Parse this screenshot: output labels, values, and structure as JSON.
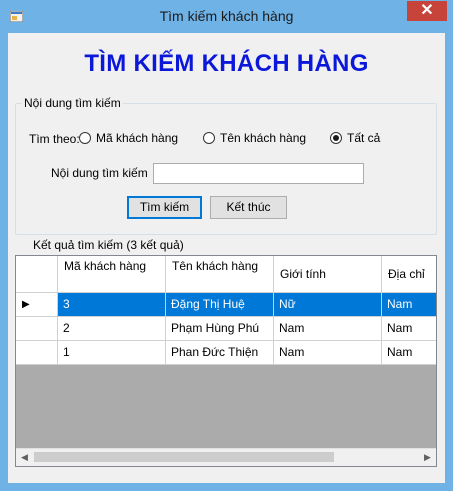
{
  "window": {
    "title": "Tìm kiếm khách hàng",
    "close_label": "✕"
  },
  "heading": "TÌM KIẾM KHÁCH HÀNG",
  "search_group": {
    "legend": "Nội dung tìm kiếm",
    "search_by_label": "Tìm theo:",
    "options": [
      {
        "label": "Mã khách hàng",
        "checked": false
      },
      {
        "label": "Tên khách hàng",
        "checked": false
      },
      {
        "label": "Tất cả",
        "checked": true
      }
    ],
    "content_label": "Nội dung tìm kiếm",
    "content_value": "",
    "search_button": "Tìm kiếm",
    "exit_button": "Kết thúc"
  },
  "results_group": {
    "legend": "Kết quả tìm kiếm (3 kết quả)",
    "columns": [
      "Mã khách hàng",
      "Tên khách hàng",
      "Giới tính",
      "Địa chỉ"
    ],
    "rows": [
      {
        "cells": [
          "3",
          "Đặng Thị Huệ",
          "Nữ",
          "Nam"
        ],
        "selected": true
      },
      {
        "cells": [
          "2",
          "Phạm Hùng Phú",
          "Nam",
          "Nam"
        ],
        "selected": false
      },
      {
        "cells": [
          "1",
          "Phan Đức Thiện",
          "Nam",
          "Nam"
        ],
        "selected": false
      }
    ],
    "current_row_marker": "▶"
  },
  "colors": {
    "title_bar": "#6fb2e6",
    "heading": "#0b18d9",
    "selection": "#0078d7",
    "close": "#c7443a"
  }
}
